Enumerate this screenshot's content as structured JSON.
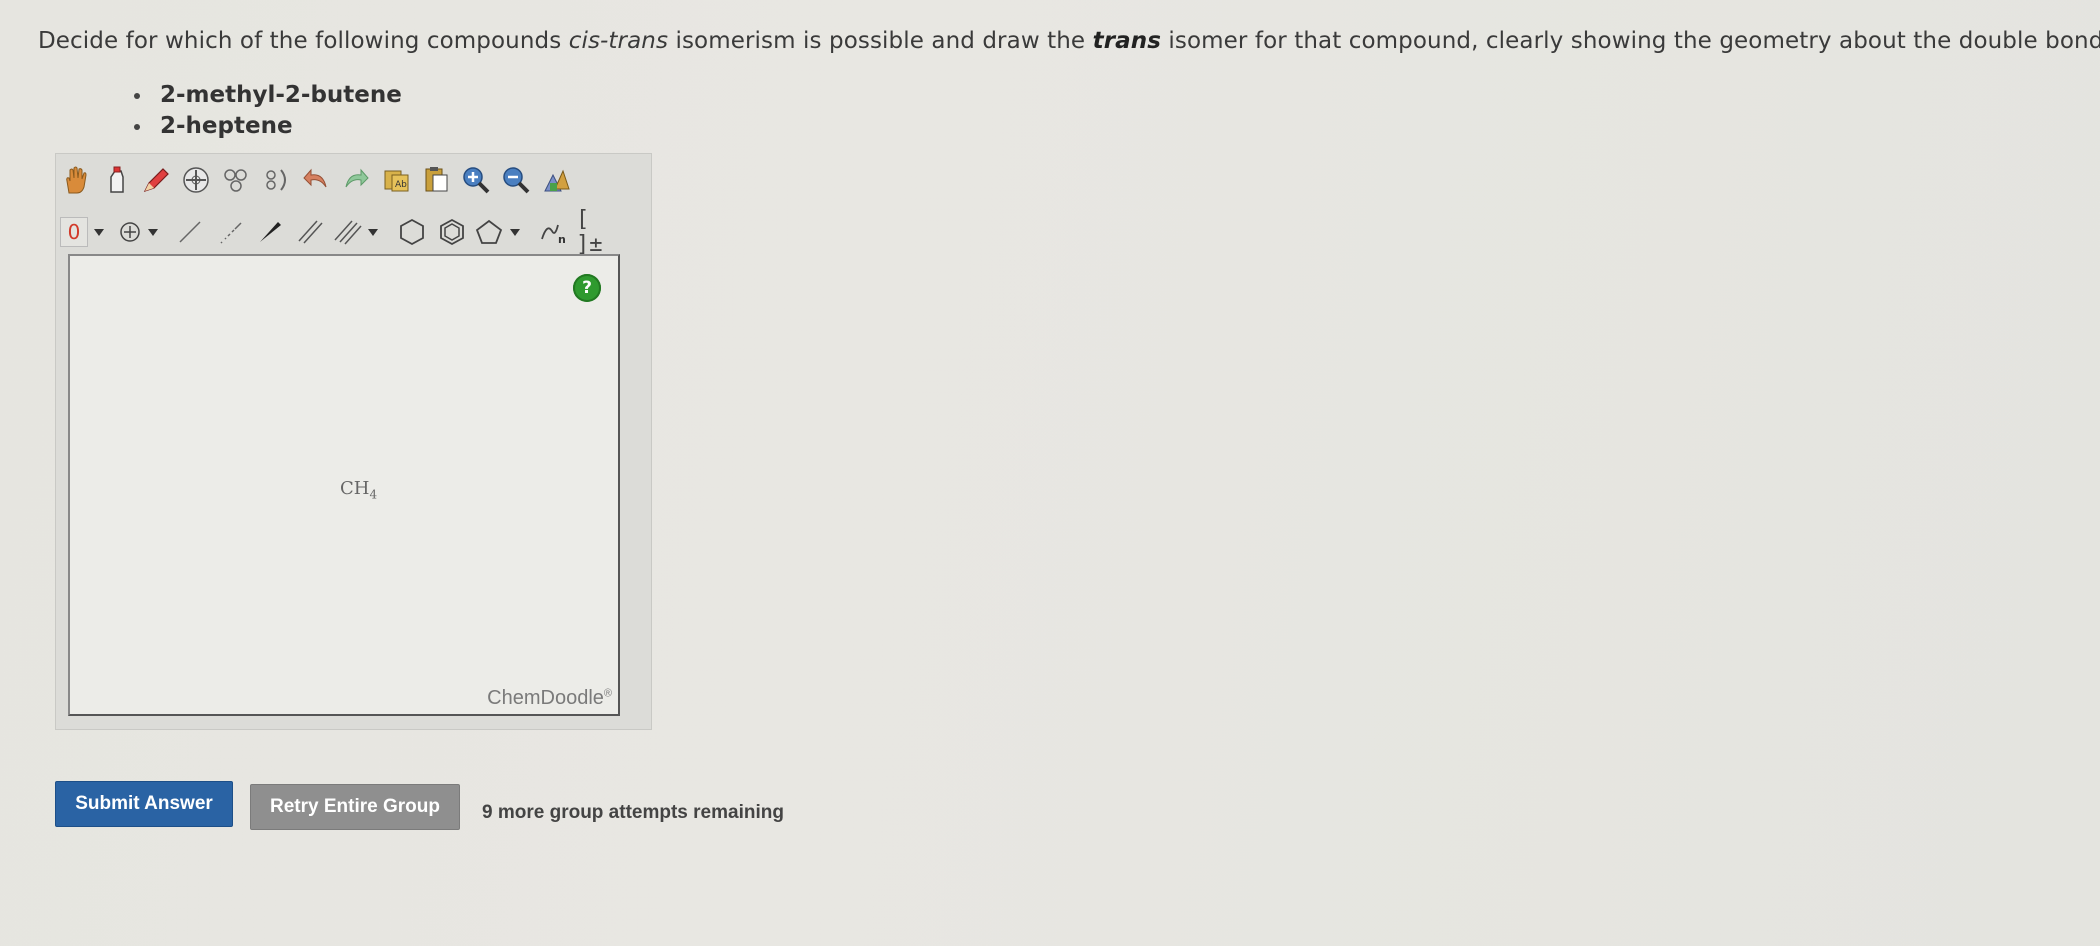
{
  "question": {
    "part1": "Decide for which of the following compounds ",
    "cis_trans": "cis-trans",
    "part2": " isomerism is possible and draw the ",
    "trans": "trans",
    "part3": " isomer for that compound, clearly showing the geometry about the double bond."
  },
  "compounds": [
    "2-methyl-2-butene",
    "2-heptene"
  ],
  "toolbar": {
    "row1_icons": [
      "hand-icon",
      "eraser-icon",
      "pencil-icon",
      "center-icon",
      "clean-icon",
      "flip-icon",
      "undo-icon",
      "redo-icon",
      "copy-icon",
      "paste-icon",
      "zoom-in-icon",
      "zoom-out-icon",
      "settings-icon"
    ],
    "charge_value": "0",
    "bracket_label": "[ ]±"
  },
  "canvas": {
    "molecule": "CH",
    "molecule_sub": "4",
    "help_label": "?",
    "watermark": "ChemDoodle",
    "watermark_reg": "®"
  },
  "actions": {
    "submit_label": "Submit Answer",
    "retry_label": "Retry Entire Group",
    "attempts_text": "9 more group attempts remaining"
  },
  "colors": {
    "submit": "#2a63a4",
    "retry": "#8f8f8f",
    "help": "#2f9a2f",
    "charge": "#d23a2a"
  }
}
